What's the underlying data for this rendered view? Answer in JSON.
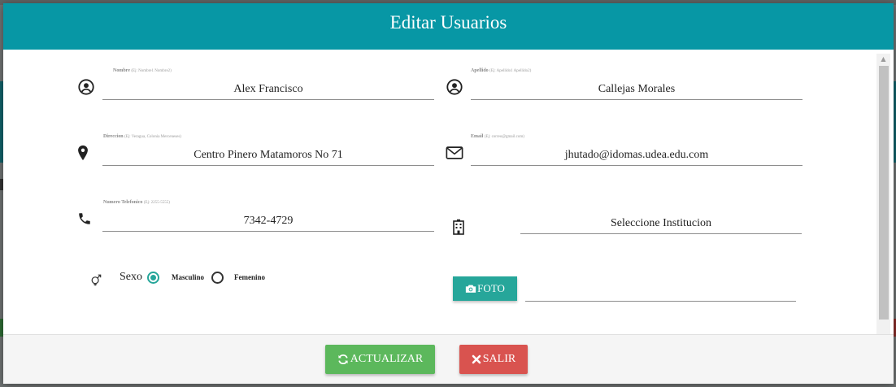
{
  "modal": {
    "title": "Editar Usuarios"
  },
  "fields": {
    "nombre": {
      "label": "Nombre",
      "hint": "(Ej: Nombre1 Nombre2)",
      "value": "Alex Francisco",
      "icon": "account-circle-icon"
    },
    "apellido": {
      "label": "Apellido",
      "hint": "(Ej: Apellido1 Apellido2)",
      "value": "Callejas Morales",
      "icon": "account-circle-icon"
    },
    "direccion": {
      "label": "Direccion",
      "hint": "(Ej: Veragua, Colonia Merceneses)",
      "value": "Centro Pinero Matamoros No 71",
      "icon": "map-marker-icon"
    },
    "email": {
      "label": "Email",
      "hint": "(Ej: correo@gmail.com)",
      "value": "jhutado@idomas.udea.edu.com",
      "icon": "envelope-icon"
    },
    "telefono": {
      "label": "Numero Telefonico",
      "hint": "(Ej: 2255-5555)",
      "value": "7342-4729",
      "icon": "phone-icon"
    },
    "institucion": {
      "value": "Seleccione Institucion",
      "icon": "building-icon"
    }
  },
  "sexo": {
    "label": "Sexo",
    "icon": "gender-icon",
    "options": [
      {
        "label": "Masculino",
        "checked": true
      },
      {
        "label": "Femenino",
        "checked": false
      }
    ]
  },
  "foto": {
    "label": "FOTO",
    "icon": "camera-icon"
  },
  "footer": {
    "update_label": "ACTUALIZAR",
    "update_icon": "refresh-icon",
    "exit_label": "SALIR",
    "exit_icon": "close-icon"
  },
  "colors": {
    "header": "#0797a5",
    "accent": "#26a69a",
    "success": "#5cb85c",
    "danger": "#d9534f"
  }
}
